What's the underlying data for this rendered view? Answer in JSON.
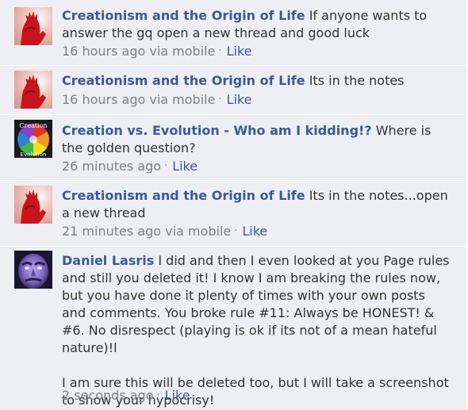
{
  "comments": [
    {
      "author": "Creationism and the Origin of Life",
      "text": "If anyone wants to answer the gq open a new thread and good luck",
      "time": "16 hours ago via mobile",
      "separator": "·",
      "like": "Like",
      "avatar_icon": "red-hand-icon"
    },
    {
      "author": "Creationism and the Origin of Life",
      "text": "Its in the notes",
      "time": "16 hours ago via mobile",
      "separator": "·",
      "like": "Like",
      "avatar_icon": "red-hand-icon"
    },
    {
      "author": "Creation vs. Evolution - Who am I kidding!?",
      "text": "Where is the golden question?",
      "time": "26 minutes ago",
      "separator": "·",
      "like": "Like",
      "avatar_icon": "rainbow-creation-evolution-icon",
      "avatar_text_top": "Creation",
      "avatar_text_bottom": "Evolution"
    },
    {
      "author": "Creationism and the Origin of Life",
      "text": "Its in the notes...open a new thread",
      "time": "21 minutes ago via mobile",
      "separator": "·",
      "like": "Like",
      "avatar_icon": "red-hand-icon"
    },
    {
      "author": "Daniel Lasris",
      "text": "I did and then I even looked at you Page rules and still you deleted it! I know I am breaking the rules now, but you have done it plenty of times with your own posts and comments. You broke rule #11: Always be HONEST! & #6. No disrespect (playing is ok if its not of a mean hateful nature)!l",
      "text2": "I am sure this will be deleted too, but I will take a screenshot to show your hypocrisy!",
      "time": "2 seconds ago",
      "separator": "·",
      "like": "Like",
      "avatar_icon": "purple-face-icon"
    }
  ],
  "colors": {
    "background": "#edeff4",
    "author": "#3b5998",
    "text": "#333333",
    "meta": "#808080"
  }
}
